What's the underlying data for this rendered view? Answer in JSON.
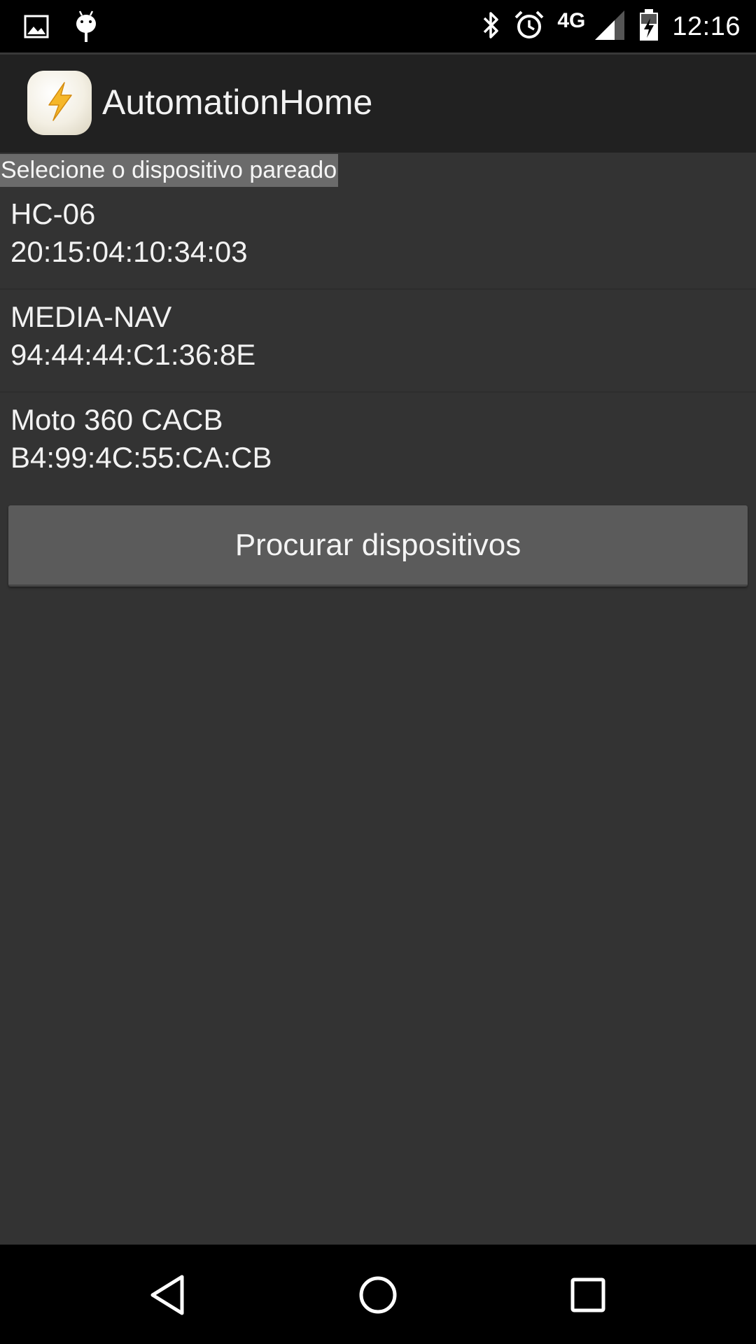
{
  "status_bar": {
    "time": "12:16",
    "network_type": "4G",
    "icons": [
      "gallery-icon",
      "android-debug-icon",
      "bluetooth-icon",
      "alarm-icon",
      "signal-icon",
      "battery-charging-icon"
    ]
  },
  "app_bar": {
    "title": "AutomationHome",
    "icon": "lightning-bolt-icon",
    "icon_color": "#f5b72a"
  },
  "content": {
    "section_label": "Selecione o dispositivo pareado",
    "devices": [
      {
        "name": "HC-06",
        "address": "20:15:04:10:34:03"
      },
      {
        "name": "MEDIA-NAV",
        "address": "94:44:44:C1:36:8E"
      },
      {
        "name": "Moto 360 CACB",
        "address": "B4:99:4C:55:CA:CB"
      }
    ],
    "scan_button_label": "Procurar dispositivos"
  },
  "nav_bar": {
    "buttons": [
      "back-icon",
      "home-icon",
      "recents-icon"
    ]
  },
  "colors": {
    "background": "#333333",
    "app_bar": "#212121",
    "button": "#5b5b5b",
    "label_bg": "#6b6b6b"
  }
}
